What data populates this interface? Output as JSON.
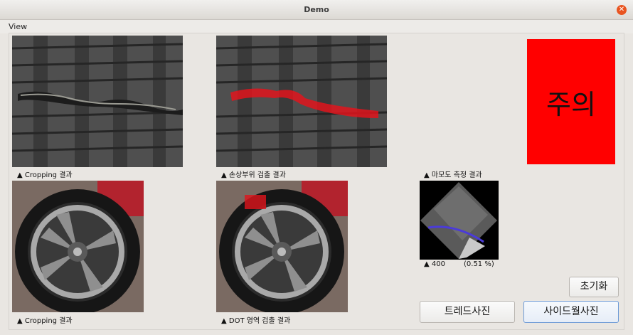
{
  "window": {
    "title": "Demo"
  },
  "menu": {
    "view": "View"
  },
  "captions": {
    "tread_crop": "▲ Cropping 결과",
    "damage_detect": "▲ 손상부위 검출 결과",
    "wear_measure": "▲ 마모도 측정 결과",
    "sidewall_crop": "▲ Cropping 결과",
    "dot_detect": "▲ DOT 영역 검출 결과"
  },
  "measure": {
    "value": "▲ 400",
    "percent": "(0.51 %)"
  },
  "status": {
    "label": "주의",
    "color": "#ff0000"
  },
  "buttons": {
    "reset": "초기화",
    "tread_photo": "트레드사진",
    "sidewall_photo": "사이드월사진"
  }
}
